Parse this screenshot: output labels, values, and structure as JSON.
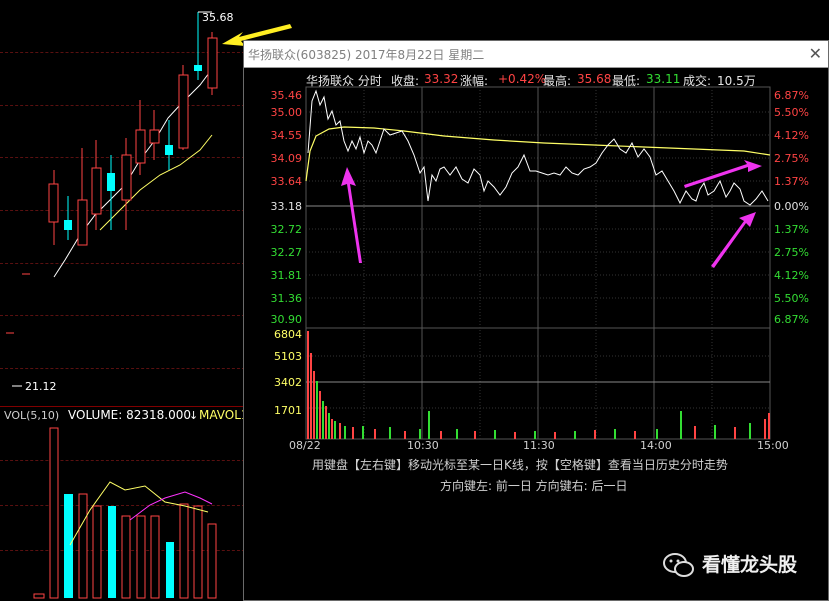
{
  "colors": {
    "up": "#ff4444",
    "down": "#00ffff",
    "white": "#ffffff",
    "yellow": "#ffff66",
    "magenta": "#ff33ff",
    "green": "#33dd33",
    "red": "#ff4444",
    "arrow_yellow": "#ffee22",
    "arrow_magenta": "#ee33ee"
  },
  "kline": {
    "high_label": "35.68",
    "low_label": "21.12",
    "vol_label": "VOL(5,10)",
    "volume_text": "VOLUME: 82318.000",
    "down_arrow": "↓",
    "mavol_text": "MAVOL1"
  },
  "window": {
    "title": "华扬联众(603825)  2017年8月22日  星期二",
    "close_icon": "✕",
    "stock_name": "华扬联众 分时",
    "close_label": "收盘:",
    "close_value": "33.32",
    "change_label": "涨幅:",
    "change_value": "+0.42%",
    "high_label": "最高:",
    "high_value": "35.68",
    "low_label": "最低:",
    "low_value": "33.11",
    "volume_label": "成交:",
    "volume_value": "10.5万",
    "price_ticks": [
      "35.46",
      "35.00",
      "34.55",
      "34.09",
      "33.64",
      "33.18",
      "32.72",
      "32.27",
      "31.81",
      "31.36",
      "30.90"
    ],
    "pct_ticks": [
      "6.87%",
      "5.50%",
      "4.12%",
      "2.75%",
      "1.37%",
      "0.00%",
      "1.37%",
      "2.75%",
      "4.12%",
      "5.50%",
      "6.87%"
    ],
    "vol_ticks": [
      "6804",
      "5103",
      "3402",
      "1701"
    ],
    "time_ticks": [
      "08/22",
      "10:30",
      "11:30",
      "14:00",
      "15:00"
    ],
    "hint1": "用键盘【左右键】移动光标至某一日K线，按【空格键】查看当日历史分时走势",
    "hint2": "方向键左: 前一日    方向键右: 后一日"
  },
  "watermark": {
    "text": "看懂龙头股",
    "icon": "wechat-icon"
  }
}
